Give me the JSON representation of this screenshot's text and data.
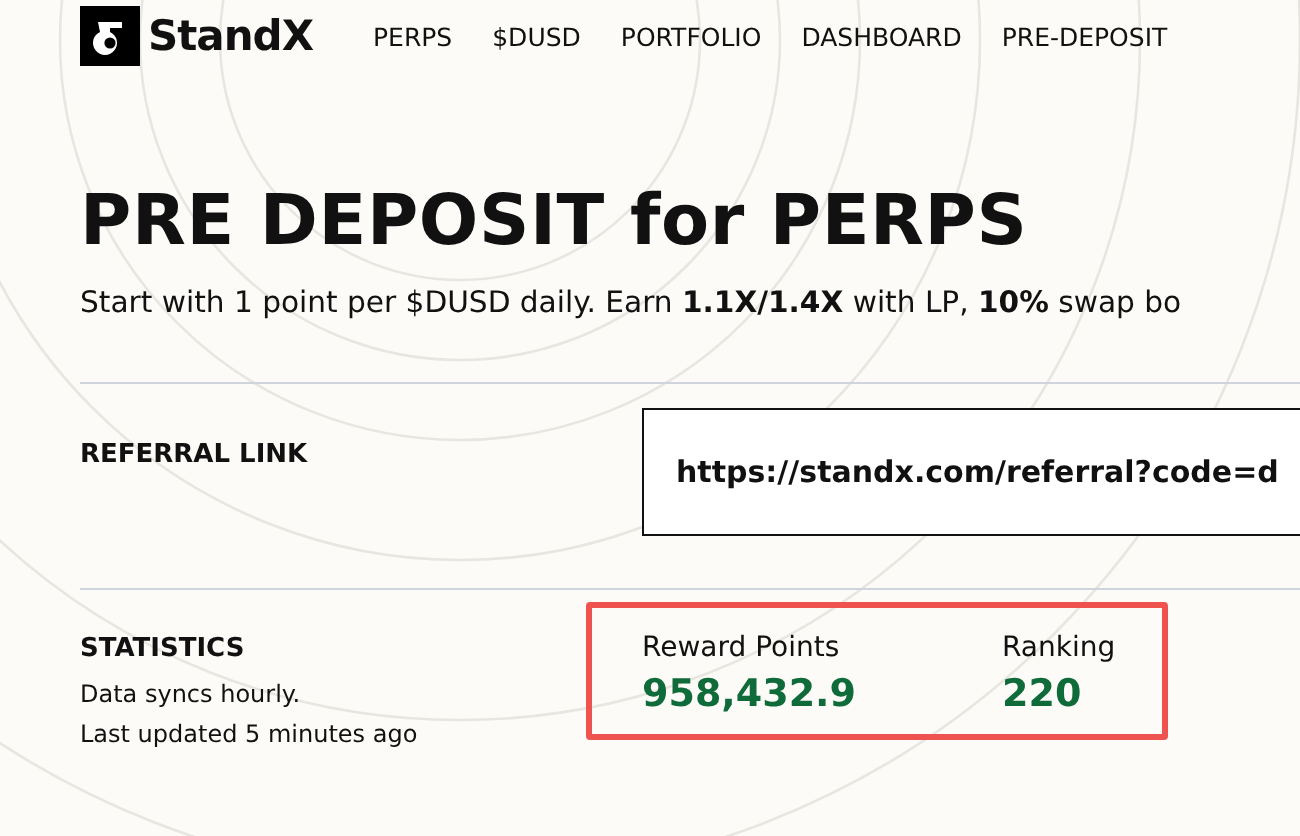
{
  "nav": {
    "logo": "StandX",
    "items": [
      {
        "label": "PERPS"
      },
      {
        "label": "$DUSD"
      },
      {
        "label": "PORTFOLIO"
      },
      {
        "label": "DASHBOARD"
      },
      {
        "label": "PRE-DEPOSIT"
      }
    ]
  },
  "title": "PRE DEPOSIT for PERPS",
  "subtitle": "Start with 1 point per $DUSD daily. Earn **1.1X/1.4X** with LP, **10%** swap bo",
  "referral": {
    "label": "REFERRAL LINK",
    "value": "https://standx.com/referral?code=d"
  },
  "statistics": {
    "label": "STATISTICS",
    "notes": [
      "Data syncs hourly.",
      "Last updated 5 minutes ago"
    ],
    "stats": [
      {
        "label": "Reward Points",
        "value": "958,432.9"
      },
      {
        "label": "Ranking",
        "value": "220"
      }
    ]
  }
}
